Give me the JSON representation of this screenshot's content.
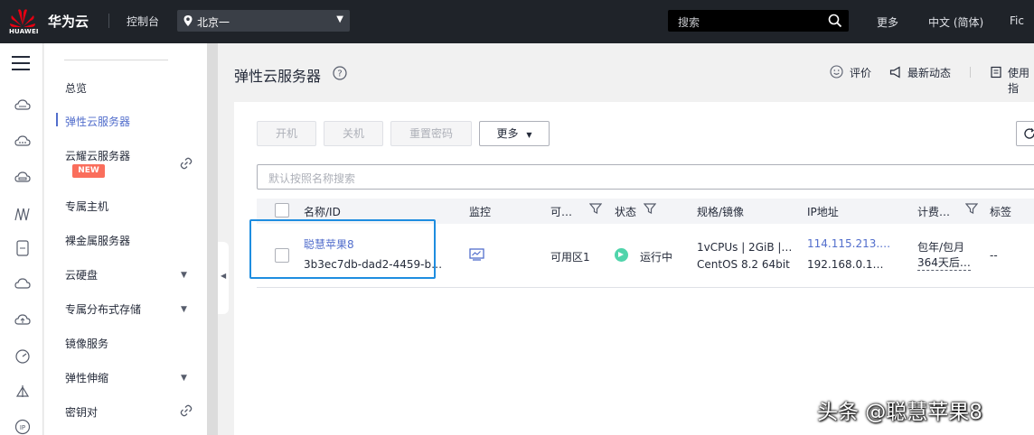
{
  "topbar": {
    "logo_text": "HUAWEI",
    "brand": "华为云",
    "console": "控制台",
    "region": "北京一",
    "search_placeholder": "搜索",
    "more": "更多",
    "language": "中文 (简体)",
    "user_partial": "Fic"
  },
  "sidemenu": {
    "items": [
      {
        "label": "总览"
      },
      {
        "label": "弹性云服务器"
      },
      {
        "label": "云耀云服务器"
      },
      {
        "label": "专属主机"
      },
      {
        "label": "裸金属服务器"
      },
      {
        "label": "云硬盘"
      },
      {
        "label": "专属分布式存储"
      },
      {
        "label": "镜像服务"
      },
      {
        "label": "弹性伸缩"
      },
      {
        "label": "密钥对"
      }
    ],
    "new_badge": "NEW"
  },
  "page": {
    "title": "弹性云服务器",
    "rate": "评价",
    "latest": "最新动态",
    "guide_partial": "使用指"
  },
  "toolbar": {
    "start": "开机",
    "stop": "关机",
    "reset_password": "重置密码",
    "more": "更多",
    "filter_placeholder": "默认按照名称搜索"
  },
  "table": {
    "headers": {
      "name": "名称/ID",
      "monitor": "监控",
      "az": "可…",
      "status": "状态",
      "spec": "规格/镜像",
      "ip": "IP地址",
      "billing": "计费…",
      "tags": "标签"
    },
    "rows": [
      {
        "name": "聪慧苹果8",
        "id": "3b3ec7db-dad2-4459-b…",
        "az": "可用区1",
        "status": "运行中",
        "spec": "1vCPUs | 2GiB |…",
        "image": "CentOS 8.2 64bit",
        "public_ip": "114.115.213.…",
        "private_ip": "192.168.0.1…",
        "billing": "包年/包月",
        "billing_expiry": "364天后…",
        "tags": "--"
      }
    ]
  },
  "watermark": "头条 @聪慧苹果8",
  "colors": {
    "accent": "#526ecc",
    "topbar_bg": "#1f2329",
    "running": "#50d4ab",
    "highlight_border": "#1e8de0",
    "new_badge": "#fa6e5c"
  }
}
